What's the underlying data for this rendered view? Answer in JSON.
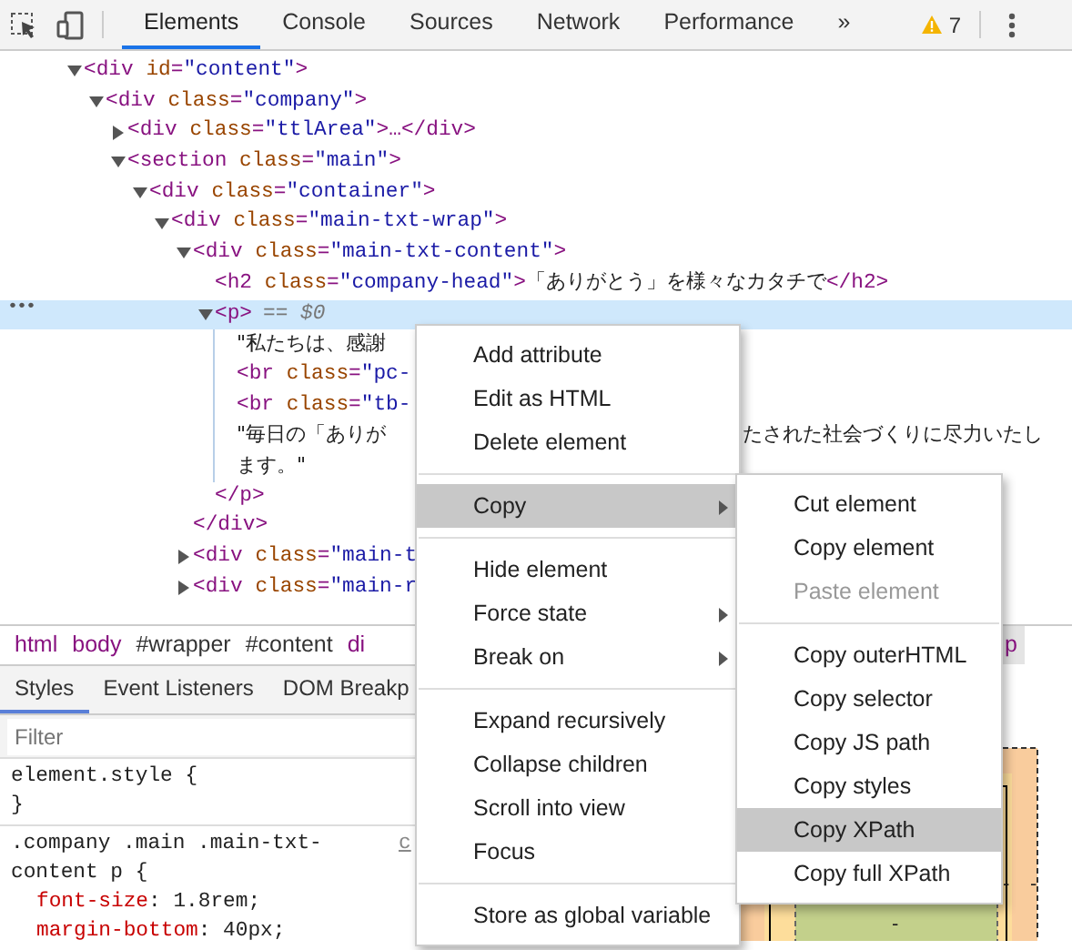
{
  "toolbar": {
    "tabs": [
      {
        "label": "Elements",
        "selected": true
      },
      {
        "label": "Console",
        "selected": false
      },
      {
        "label": "Sources",
        "selected": false
      },
      {
        "label": "Network",
        "selected": false
      },
      {
        "label": "Performance",
        "selected": false
      }
    ],
    "more": "»",
    "warnings": "7"
  },
  "dom_tree": [
    {
      "kind": "element",
      "markup": "<div id=\"content\">",
      "expanded": true,
      "children": [
        {
          "kind": "element",
          "markup": "<div class=\"company\">",
          "expanded": true,
          "children": [
            {
              "kind": "element",
              "markup": "<div class=\"ttlArea\">…</div>",
              "expanded": false
            },
            {
              "kind": "element",
              "markup": "<section class=\"main\">",
              "expanded": true,
              "children": [
                {
                  "kind": "element",
                  "markup": "<div class=\"container\">",
                  "expanded": true,
                  "children": [
                    {
                      "kind": "element",
                      "markup": "<div class=\"main-txt-wrap\">",
                      "expanded": true,
                      "children": [
                        {
                          "kind": "element",
                          "markup": "<div class=\"main-txt-content\">",
                          "expanded": true,
                          "close": "</div>",
                          "children": [
                            {
                              "kind": "leaf",
                              "markup": "<h2 class=\"company-head\">",
                              "text": "「ありがとう」を様々なカタチで",
                              "end": "</h2>"
                            },
                            {
                              "kind": "element",
                              "markup": "<p>",
                              "suffix": "== $0",
                              "gutter": "•••",
                              "selected": true,
                              "expanded": true,
                              "close": "</p>",
                              "children": [
                                {
                                  "kind": "text",
                                  "text": "\"私たちは、感謝"
                                },
                                {
                                  "kind": "leaf",
                                  "markup": "<br class=\"pc-"
                                },
                                {
                                  "kind": "leaf",
                                  "markup": "<br class=\"tb-"
                                },
                                {
                                  "kind": "text",
                                  "text": "\"毎日の「ありが",
                                  "tail": "たされた社会づくりに尽力いたし",
                                  "continuation": "ます。\""
                                }
                              ]
                            }
                          ]
                        },
                        {
                          "kind": "element",
                          "markup": "<div class=\"main-t",
                          "expanded": false
                        },
                        {
                          "kind": "element",
                          "markup": "<div class=\"main-r",
                          "expanded": false
                        }
                      ]
                    }
                  ]
                }
              ]
            }
          ]
        }
      ]
    }
  ],
  "breadcrumb": [
    {
      "text": "html",
      "kind": "tag",
      "selected": false
    },
    {
      "text": "body",
      "kind": "tag",
      "selected": false
    },
    {
      "text": "#wrapper",
      "kind": "id",
      "selected": false
    },
    {
      "text": "#content",
      "kind": "id",
      "selected": false
    },
    {
      "text": "di",
      "kind": "tag",
      "selected": false
    },
    {
      "text": "p",
      "kind": "tag",
      "selected": true
    }
  ],
  "styles_tabs": [
    {
      "label": "Styles",
      "selected": true
    },
    {
      "label": "Event Listeners",
      "selected": false
    },
    {
      "label": "DOM Breakp",
      "selected": false
    }
  ],
  "filter": {
    "placeholder": "Filter"
  },
  "rules": [
    {
      "selector": "element.style {",
      "close": "}"
    },
    {
      "selector": ".company .main .main-txt-",
      "selector_2": "content p {",
      "source": "c",
      "declarations": [
        {
          "property": "font-size",
          "value": ": 1.8rem;"
        },
        {
          "property": "margin-bottom",
          "value": ": 40px;"
        }
      ]
    }
  ],
  "box_model": {
    "labels": [
      "-",
      "-",
      "-"
    ]
  },
  "context_menu": [
    {
      "kind": "item",
      "label": "Add attribute",
      "selected": false
    },
    {
      "kind": "item",
      "label": "Edit as HTML",
      "selected": false
    },
    {
      "kind": "item",
      "label": "Delete element",
      "selected": false
    },
    {
      "kind": "separator"
    },
    {
      "kind": "item",
      "label": "Copy",
      "selected": true,
      "submenu": true
    },
    {
      "kind": "separator"
    },
    {
      "kind": "item",
      "label": "Hide element",
      "selected": false
    },
    {
      "kind": "item",
      "label": "Force state",
      "selected": false,
      "submenu": true
    },
    {
      "kind": "item",
      "label": "Break on",
      "selected": false,
      "submenu": true
    },
    {
      "kind": "separator"
    },
    {
      "kind": "item",
      "label": "Expand recursively",
      "selected": false
    },
    {
      "kind": "item",
      "label": "Collapse children",
      "selected": false
    },
    {
      "kind": "item",
      "label": "Scroll into view",
      "selected": false
    },
    {
      "kind": "item",
      "label": "Focus",
      "selected": false
    },
    {
      "kind": "separator"
    },
    {
      "kind": "item",
      "label": "Store as global variable",
      "selected": false
    }
  ],
  "copy_submenu": [
    {
      "kind": "item",
      "label": "Cut element",
      "selected": false,
      "disabled": false
    },
    {
      "kind": "item",
      "label": "Copy element",
      "selected": false,
      "disabled": false
    },
    {
      "kind": "item",
      "label": "Paste element",
      "selected": false,
      "disabled": true
    },
    {
      "kind": "separator"
    },
    {
      "kind": "item",
      "label": "Copy outerHTML",
      "selected": false,
      "disabled": false
    },
    {
      "kind": "item",
      "label": "Copy selector",
      "selected": false,
      "disabled": false
    },
    {
      "kind": "item",
      "label": "Copy JS path",
      "selected": false,
      "disabled": false
    },
    {
      "kind": "item",
      "label": "Copy styles",
      "selected": false,
      "disabled": false
    },
    {
      "kind": "item",
      "label": "Copy XPath",
      "selected": true,
      "disabled": false
    },
    {
      "kind": "item",
      "label": "Copy full XPath",
      "selected": false,
      "disabled": false
    }
  ]
}
